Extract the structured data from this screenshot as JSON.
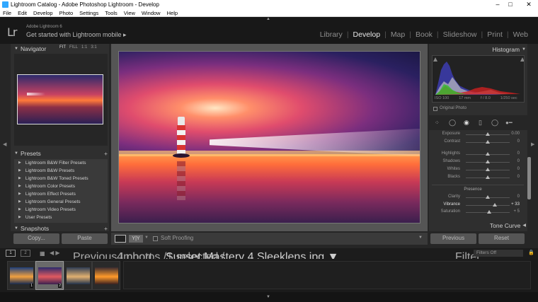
{
  "window": {
    "title": "Lightroom Catalog - Adobe Photoshop Lightroom - Develop",
    "controls": [
      "–",
      "□",
      "✕"
    ]
  },
  "menu": [
    "File",
    "Edit",
    "Develop",
    "Photo",
    "Settings",
    "Tools",
    "View",
    "Window",
    "Help"
  ],
  "identity": {
    "logo": "Lr",
    "product": "Adobe Lightroom 6",
    "tagline": "Get started with Lightroom mobile ▸"
  },
  "modules": {
    "items": [
      "Library",
      "Develop",
      "Map",
      "Book",
      "Slideshow",
      "Print",
      "Web"
    ],
    "active": "Develop"
  },
  "navigator": {
    "title": "Navigator",
    "options": [
      "FIT",
      "FILL",
      "1:1",
      "3:1"
    ],
    "active_option": "FIT"
  },
  "presets": {
    "title": "Presets",
    "add": "+",
    "items": [
      "Lightroom B&W Filter Presets",
      "Lightroom B&W Presets",
      "Lightroom B&W Toned Presets",
      "Lightroom Color Presets",
      "Lightroom Effect Presets",
      "Lightroom General Presets",
      "Lightroom Video Presets",
      "User Presets"
    ]
  },
  "snapshots": {
    "title": "Snapshots",
    "add": "+"
  },
  "left_buttons": {
    "copy": "Copy...",
    "paste": "Paste"
  },
  "toolbar": {
    "view_yy": "Y|Y",
    "soft_proofing": "Soft Proofing"
  },
  "histogram": {
    "title": "Histogram",
    "iso": "ISO 100",
    "focal": "17 mm",
    "aperture": "f / 8.0",
    "shutter": "1/250 sec",
    "original_photo": "Original Photo"
  },
  "basic": {
    "sliders": [
      {
        "label": "Exposure",
        "value": "0.00",
        "pos": 0.5
      },
      {
        "label": "Contrast",
        "value": "0",
        "pos": 0.5
      },
      {
        "label": "Highlights",
        "value": "0",
        "pos": 0.5
      },
      {
        "label": "Shadows",
        "value": "0",
        "pos": 0.5
      },
      {
        "label": "Whites",
        "value": "0",
        "pos": 0.5
      },
      {
        "label": "Blacks",
        "value": "0",
        "pos": 0.5
      }
    ],
    "presence_title": "Presence",
    "presence": [
      {
        "label": "Clarity",
        "value": "0",
        "pos": 0.5
      },
      {
        "label": "Vibrance",
        "value": "+ 33",
        "pos": 0.66
      },
      {
        "label": "Saturation",
        "value": "+ 5",
        "pos": 0.53
      }
    ]
  },
  "tone_curve": {
    "title": "Tone Curve"
  },
  "right_buttons": {
    "previous": "Previous",
    "reset": "Reset"
  },
  "filmstrip_bar": {
    "screen1": "1",
    "screen2": "2",
    "source": "Previous Import",
    "count": "4 photos /1 selected /",
    "filename": "Sunset Mastery 4 Sleeklens.jpg",
    "filter_label": "Filter :",
    "filter_value": "Filters Off"
  },
  "filmstrip": {
    "selected_index": 1,
    "thumbs": [
      {
        "badge": "1",
        "colors": [
          "#1e3f7a",
          "#f0a040",
          "#15284f"
        ]
      },
      {
        "badge": "2",
        "colors": [
          "#2c2a6b",
          "#e05a60",
          "#3a2050"
        ]
      },
      {
        "badge": "",
        "colors": [
          "#2f3d55",
          "#e0b070",
          "#20304a"
        ]
      },
      {
        "badge": "",
        "colors": [
          "#3a2b30",
          "#ff9a2a",
          "#3a2020"
        ]
      }
    ]
  },
  "colors": {
    "panel": "#2f2f2f",
    "background": "#262626",
    "active_module": "#e8e8e8"
  }
}
